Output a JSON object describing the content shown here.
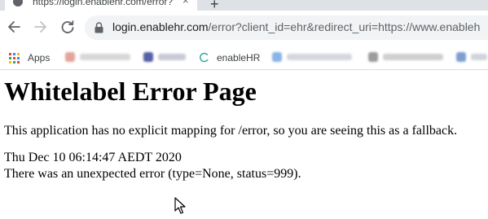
{
  "browser": {
    "tab": {
      "title": "https://login.enablehr.com/error?",
      "close_glyph": "×",
      "favicon_icon": "globe-icon"
    },
    "new_tab_glyph": "+",
    "toolbar": {
      "back_icon": "arrow-left-icon",
      "forward_icon": "arrow-right-icon",
      "reload_icon": "reload-icon",
      "lock_icon": "lock-icon",
      "url_host": "login.enablehr.com",
      "url_rest": "/error?client_id=ehr&redirect_uri=https://www.enableh"
    },
    "bookmarks": {
      "apps_label": "Apps",
      "enablehr_label": "enableHR"
    }
  },
  "page": {
    "heading": "Whitelabel Error Page",
    "message": "This application has no explicit mapping for /error, so you are seeing this as a fallback.",
    "timestamp": "Thu Dec 10 06:14:47 AEDT 2020",
    "error_detail": "There was an unexpected error (type=None, status=999)."
  },
  "colors": {
    "tabstrip": "#dee1e6",
    "omnibox": "#f1f3f4",
    "text": "#000000"
  }
}
